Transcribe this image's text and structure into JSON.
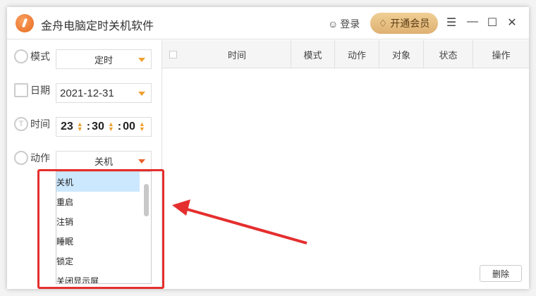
{
  "app": {
    "title": "金舟电脑定时关机软件",
    "login": "登录",
    "vip": "开通会员"
  },
  "form": {
    "mode": {
      "label": "模式",
      "value": "定时"
    },
    "date": {
      "label": "日期",
      "value": "2021-12-31"
    },
    "time": {
      "label": "时间",
      "hour": "23",
      "minute": "30",
      "second": "00"
    },
    "action": {
      "label": "动作",
      "value": "关机",
      "options": [
        "关机",
        "重启",
        "注销",
        "睡眠",
        "锁定",
        "关闭显示屏"
      ]
    }
  },
  "table": {
    "columns": [
      "时间",
      "模式",
      "动作",
      "对象",
      "状态",
      "操作"
    ]
  },
  "delete_label": "删除",
  "colors": {
    "accent": "#f0a030",
    "highlight": "#e52e2e"
  }
}
